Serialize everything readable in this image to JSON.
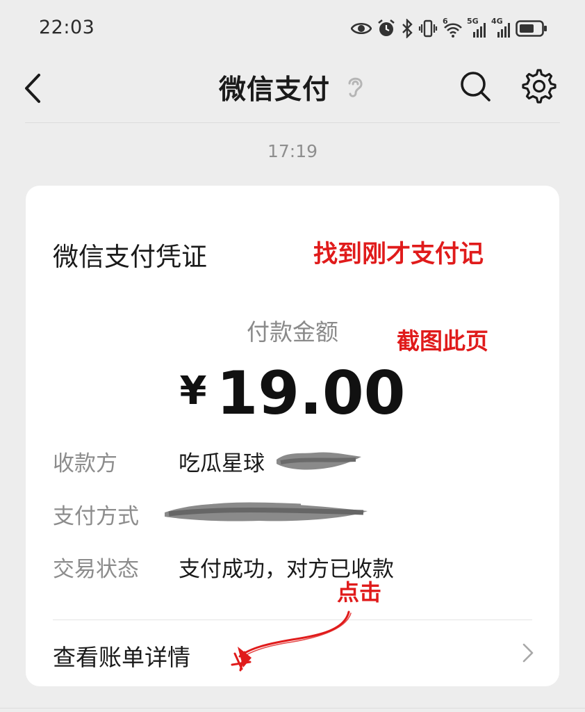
{
  "status_bar": {
    "time": "22:03",
    "icons": [
      "eye-icon",
      "alarm-icon",
      "bluetooth-icon",
      "vibrate-icon",
      "wifi-6-icon",
      "signal-5g-icon",
      "signal-4g-icon",
      "battery-icon"
    ],
    "wifi_label": "6",
    "signal1_label": "5G",
    "signal2_label": "4G"
  },
  "navbar": {
    "title": "微信支付",
    "icons": [
      "back-chevron-icon",
      "ear-icon",
      "search-icon",
      "gear-icon"
    ]
  },
  "message_time": "17:19",
  "receipt": {
    "title": "微信支付凭证",
    "amount_label": "付款金额",
    "currency": "¥",
    "amount": "19.00",
    "rows": [
      {
        "label": "收款方",
        "value": "吃瓜星球"
      },
      {
        "label": "支付方式",
        "value": ""
      },
      {
        "label": "交易状态",
        "value": "支付成功，对方已收款"
      }
    ],
    "link_label": "查看账单详情"
  },
  "annotations": {
    "find": "找到刚才支付记",
    "screenshot": "截图此页",
    "click": "点击",
    "color": "#e01b1b"
  },
  "colors": {
    "background": "#ededed",
    "card": "#ffffff",
    "annotation": "#e01b1b"
  }
}
